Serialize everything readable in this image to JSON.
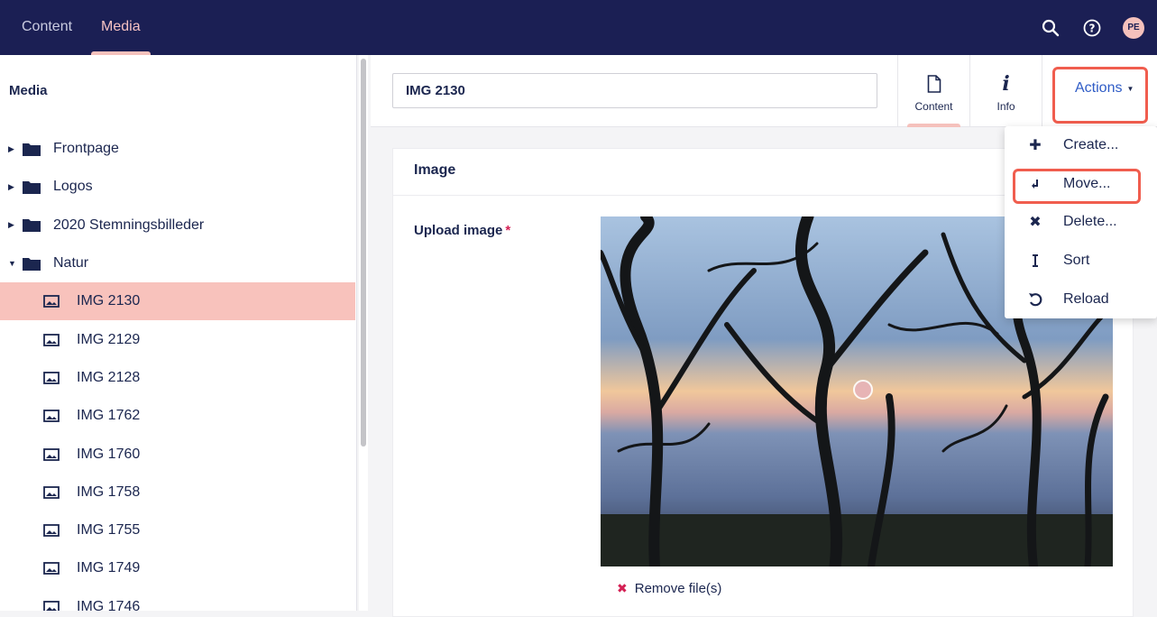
{
  "header": {
    "tabs": [
      {
        "label": "Content",
        "active": false
      },
      {
        "label": "Media",
        "active": true
      }
    ],
    "icons": [
      "search-icon",
      "help-icon"
    ],
    "user_initials": "PE"
  },
  "sidebar": {
    "title": "Media",
    "items": [
      {
        "label": "Frontpage",
        "type": "folder",
        "expanded": false
      },
      {
        "label": "Logos",
        "type": "folder",
        "expanded": false
      },
      {
        "label": "2020 Stemningsbilleder",
        "type": "folder",
        "expanded": false
      },
      {
        "label": "Natur",
        "type": "folder",
        "expanded": true
      },
      {
        "label": "IMG 2130",
        "type": "image",
        "selected": true
      },
      {
        "label": "IMG 2129",
        "type": "image"
      },
      {
        "label": "IMG 2128",
        "type": "image"
      },
      {
        "label": "IMG 1762",
        "type": "image"
      },
      {
        "label": "IMG 1760",
        "type": "image"
      },
      {
        "label": "IMG 1758",
        "type": "image"
      },
      {
        "label": "IMG 1755",
        "type": "image"
      },
      {
        "label": "IMG 1749",
        "type": "image"
      },
      {
        "label": "IMG 1746",
        "type": "image"
      }
    ]
  },
  "editor": {
    "name_value": "IMG 2130",
    "apps": [
      {
        "label": "Content",
        "icon": "document-icon",
        "active": true
      },
      {
        "label": "Info",
        "icon": "info-icon",
        "active": false
      }
    ],
    "actions_label": "Actions"
  },
  "panel": {
    "title": "Image",
    "field_label": "Upload image",
    "required_mark": "*",
    "remove_label": "Remove file(s)"
  },
  "actions_menu": {
    "items": [
      {
        "label": "Create...",
        "icon": "plus-icon"
      },
      {
        "label": "Move...",
        "icon": "move-icon",
        "highlighted": true
      },
      {
        "label": "Delete...",
        "icon": "delete-icon"
      },
      {
        "label": "Sort",
        "icon": "sort-icon"
      },
      {
        "label": "Reload",
        "icon": "reload-icon"
      }
    ]
  },
  "colors": {
    "header_bg": "#1b1f54",
    "accent_pink": "#f5c1bc",
    "selected_row": "#f8c2bc",
    "link_blue": "#2f5cc6",
    "highlight_red": "#f05d4e",
    "required_red": "#d42054"
  }
}
